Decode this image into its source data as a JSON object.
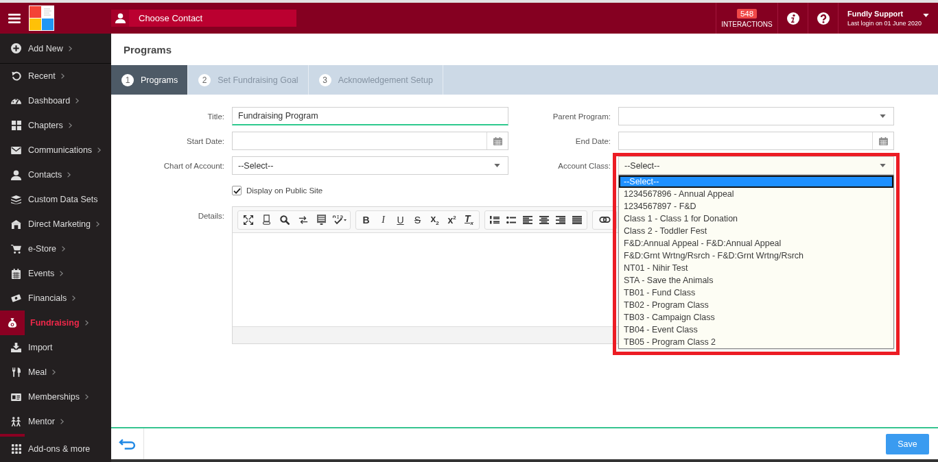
{
  "top_bar": {
    "contact_button": "Choose Contact",
    "interactions": {
      "count": "548",
      "label": "INTERACTIONS"
    },
    "user": {
      "name": "Fundly Support",
      "last_login": "Last login on 01 June 2020"
    }
  },
  "sidebar": {
    "add_new": {
      "label": "Add New",
      "has_submenu": true
    },
    "items": [
      {
        "label": "Recent",
        "has_submenu": true,
        "selected": false
      },
      {
        "label": "Dashboard",
        "has_submenu": true,
        "selected": false
      },
      {
        "label": "Chapters",
        "has_submenu": true,
        "selected": false
      },
      {
        "label": "Communications",
        "has_submenu": true,
        "selected": false
      },
      {
        "label": "Contacts",
        "has_submenu": true,
        "selected": false
      },
      {
        "label": "Custom Data Sets",
        "has_submenu": false,
        "selected": false
      },
      {
        "label": "Direct Marketing",
        "has_submenu": true,
        "selected": false
      },
      {
        "label": "e-Store",
        "has_submenu": true,
        "selected": false
      },
      {
        "label": "Events",
        "has_submenu": true,
        "selected": false
      },
      {
        "label": "Financials",
        "has_submenu": true,
        "selected": false
      },
      {
        "label": "Fundraising",
        "has_submenu": true,
        "selected": true
      },
      {
        "label": "Import",
        "has_submenu": false,
        "selected": false
      },
      {
        "label": "Meal",
        "has_submenu": true,
        "selected": false
      },
      {
        "label": "Memberships",
        "has_submenu": true,
        "selected": false
      },
      {
        "label": "Mentor",
        "has_submenu": true,
        "selected": false
      }
    ],
    "more": {
      "label": "Add-ons & more",
      "has_submenu": false
    }
  },
  "page": {
    "title": "Programs"
  },
  "steps": [
    {
      "number": "1",
      "label": "Programs",
      "selected": true
    },
    {
      "number": "2",
      "label": "Set Fundraising Goal",
      "selected": false
    },
    {
      "number": "3",
      "label": "Acknowledgement Setup",
      "selected": false
    }
  ],
  "form": {
    "left": [
      {
        "kind": "text",
        "label": "Title:",
        "value": "Fundraising Program",
        "focused": true
      },
      {
        "kind": "date",
        "label": "Start Date:"
      },
      {
        "kind": "select",
        "label": "Chart of Account:",
        "value": "--Select--",
        "open": false
      },
      {
        "kind": "checkbox",
        "label": "Display on Public Site",
        "checked": true
      },
      {
        "kind": "editor",
        "label": "Details:",
        "format_buttons": [
          {
            "kind": "bold",
            "glyph": "B"
          },
          {
            "kind": "italic",
            "glyph": "I"
          },
          {
            "kind": "underline",
            "glyph": "U"
          },
          {
            "kind": "strike",
            "glyph": "S"
          },
          {
            "kind": "subscript",
            "glyph": "x$_{2}$"
          },
          {
            "kind": "superscript",
            "glyph": "x$^{2}$"
          },
          {
            "kind": "clear",
            "glyph": "T$_{x}$"
          }
        ]
      }
    ],
    "right": [
      {
        "kind": "select",
        "label": "Parent Program:",
        "open": false
      },
      {
        "kind": "date",
        "label": "End Date:"
      },
      {
        "kind": "select",
        "label": "Account Class:",
        "value": "--Select--",
        "open": true,
        "highlighted": true,
        "options": [
          {
            "label": "--Select--",
            "selected": true
          },
          {
            "label": "1234567896 - Annual Appeal",
            "selected": false
          },
          {
            "label": "1234567897 - F&D",
            "selected": false
          },
          {
            "label": "Class 1 - Class 1 for Donation",
            "selected": false
          },
          {
            "label": "Class 2 - Toddler Fest",
            "selected": false
          },
          {
            "label": "F&D:Annual Appeal - F&D:Annual Appeal",
            "selected": false
          },
          {
            "label": "F&D:Grnt Wrtng/Rsrch - F&D:Grnt Wrtng/Rsrch",
            "selected": false
          },
          {
            "label": "NT01 - Nihir Test",
            "selected": false
          },
          {
            "label": "STA - Save the Animals",
            "selected": false
          },
          {
            "label": "TB01 - Fund Class",
            "selected": false
          },
          {
            "label": "TB02 - Program Class",
            "selected": false
          },
          {
            "label": "TB03 - Campaign Class",
            "selected": false
          },
          {
            "label": "TB04 - Event Class",
            "selected": false
          },
          {
            "label": "TB05 - Program Class 2",
            "selected": false
          }
        ]
      }
    ]
  },
  "footer": {
    "save_button": "Save"
  }
}
